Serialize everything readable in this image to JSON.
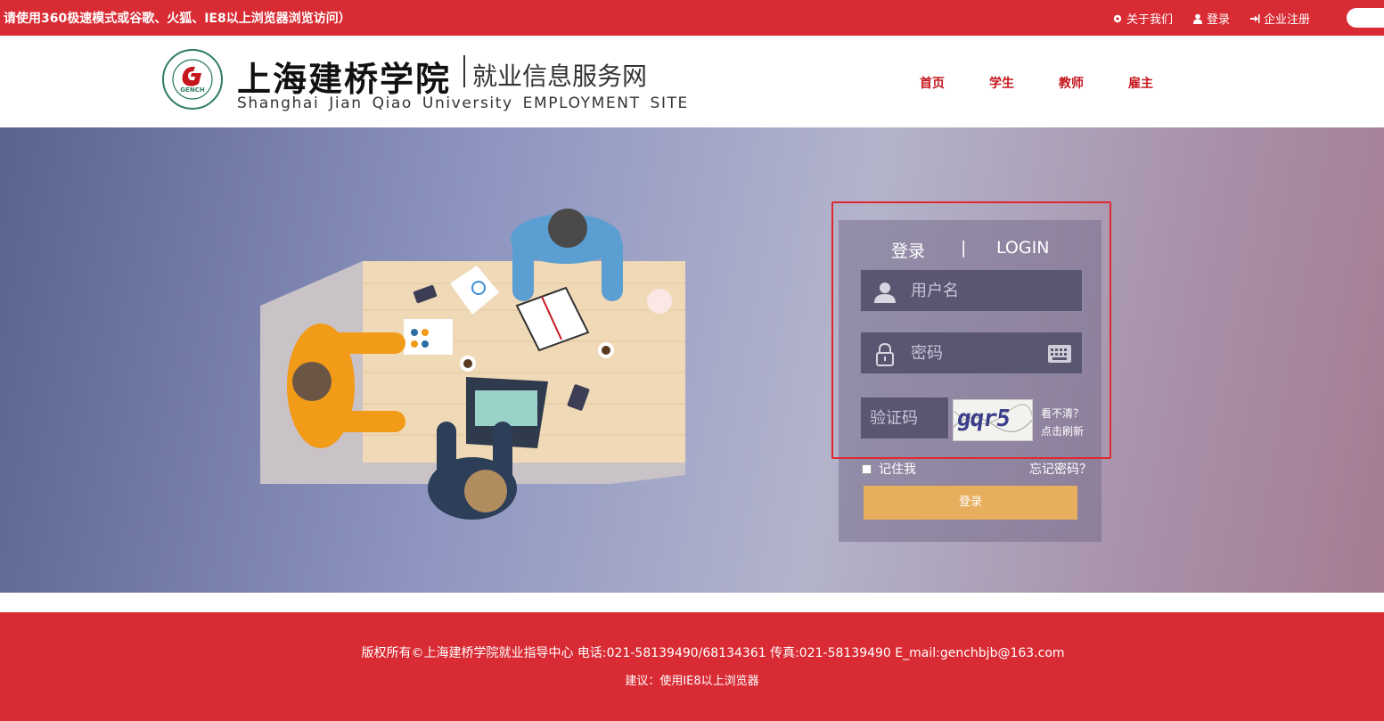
{
  "topbar": {
    "notice": "请使用360极速模式或谷歌、火狐、IE8以上浏览器浏览访问）",
    "links": [
      {
        "icon": "gear-icon",
        "label": "关于我们"
      },
      {
        "icon": "user-icon",
        "label": "登录"
      },
      {
        "icon": "sign-in-icon",
        "label": "企业注册"
      }
    ]
  },
  "header": {
    "logo_cn": "上海建桥学院",
    "logo_sub": "就业信息服务网",
    "logo_en": "Shanghai Jian Qiao University  EMPLOYMENT SITE",
    "seal_text": "GENCH",
    "nav": [
      "首页",
      "学生",
      "教师",
      "雇主"
    ]
  },
  "login": {
    "title_cn": "登录",
    "title_sep": "|",
    "title_en": "LOGIN",
    "username_placeholder": "用户名",
    "password_placeholder": "密码",
    "captcha_placeholder": "验证码",
    "captcha_text": "gqr5",
    "refresh_line1": "看不清？",
    "refresh_line2": "点击刷新",
    "remember_label": "记住我",
    "forgot_label": "忘记密码？",
    "submit_label": "登录"
  },
  "footer": {
    "line1": "版权所有©上海建桥学院就业指导中心    电话:021-58139490/68134361 传真:021-58139490    E_mail:genchbjb@163.com",
    "line2": "建议：使用IE8以上浏览器"
  },
  "colors": {
    "brand_red": "#d92b34",
    "nav_red": "#c4161c",
    "button_gold": "#e6ae5d"
  }
}
